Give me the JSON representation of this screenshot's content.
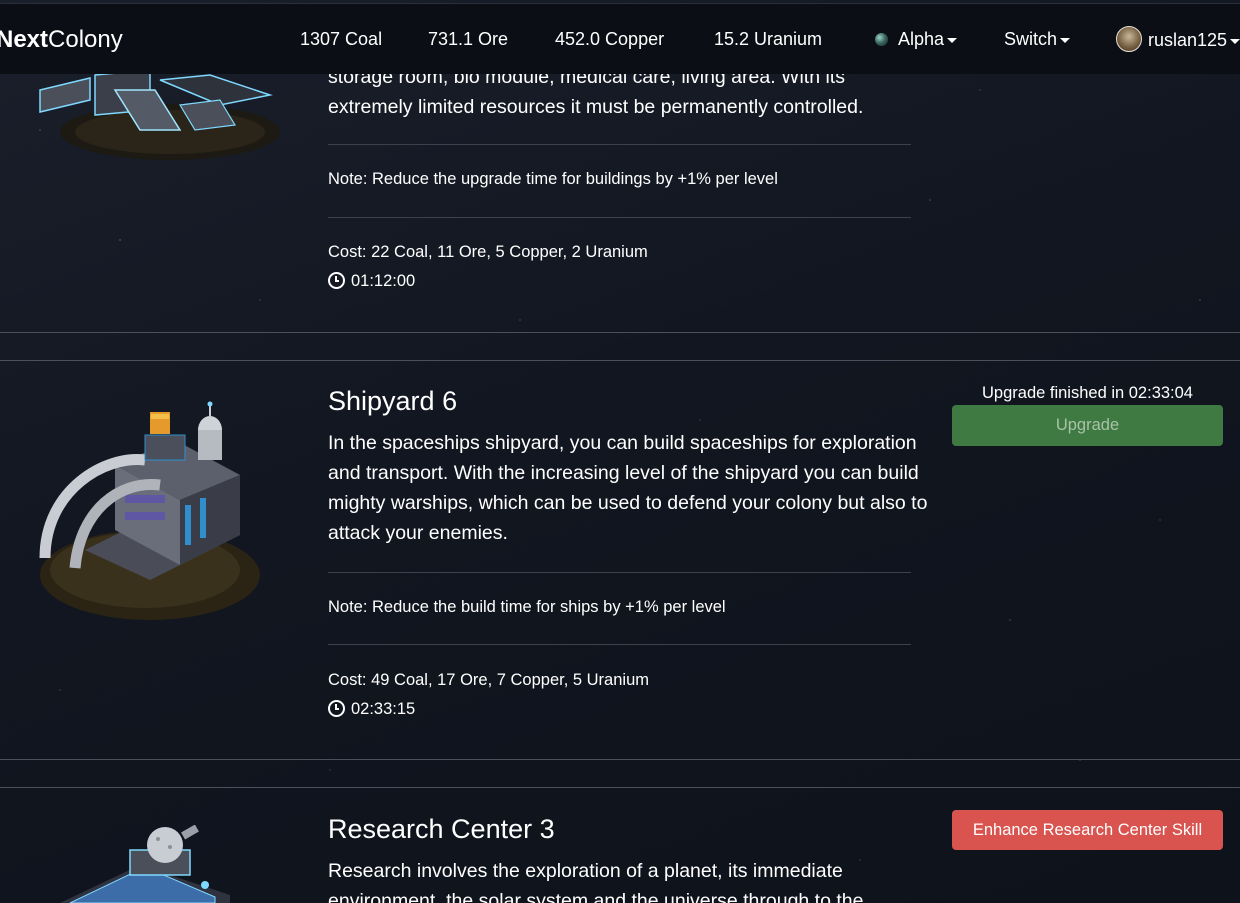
{
  "nav": {
    "brand_bold": "Next",
    "brand_light": "Colony",
    "resources": [
      {
        "label": "1307 Coal"
      },
      {
        "label": "731.1 Ore"
      },
      {
        "label": "452.0 Copper"
      },
      {
        "label": "15.2 Uranium"
      }
    ],
    "planet_label": "Alpha",
    "switch_label": "Switch",
    "user_label": "ruslan125"
  },
  "buildings": [
    {
      "description_partial": "storage room, bio module, medical care, living area. With its extremely limited resources it must be permanently controlled.",
      "note": "Note: Reduce the upgrade time for buildings by +1% per level",
      "cost": "Cost: 22 Coal, 11 Ore, 5 Copper, 2 Uranium",
      "time": "01:12:00"
    },
    {
      "title": "Shipyard 6",
      "description": "In the spaceships shipyard, you can build spaceships for exploration and transport. With the increasing level of the shipyard you can build mighty warships, which can be used to defend your colony but also to attack your enemies.",
      "note": "Note: Reduce the build time for ships by +1% per level",
      "cost": "Cost: 49 Coal, 17 Ore, 7 Copper, 5 Uranium",
      "time": "02:33:15",
      "status": "Upgrade finished in 02:33:04",
      "button_label": "Upgrade"
    },
    {
      "title": "Research Center 3",
      "description_partial": "Research involves the exploration of a planet, its immediate environment, the solar system and the universe through to the",
      "button_label": "Enhance Research Center Skill"
    }
  ],
  "colors": {
    "upgrade_button": "#3e7a41",
    "research_button": "#d9534f",
    "navbar": "#0b0e15"
  },
  "icons": [
    "planet-icon",
    "caret-down-icon",
    "avatar",
    "clock-icon"
  ]
}
